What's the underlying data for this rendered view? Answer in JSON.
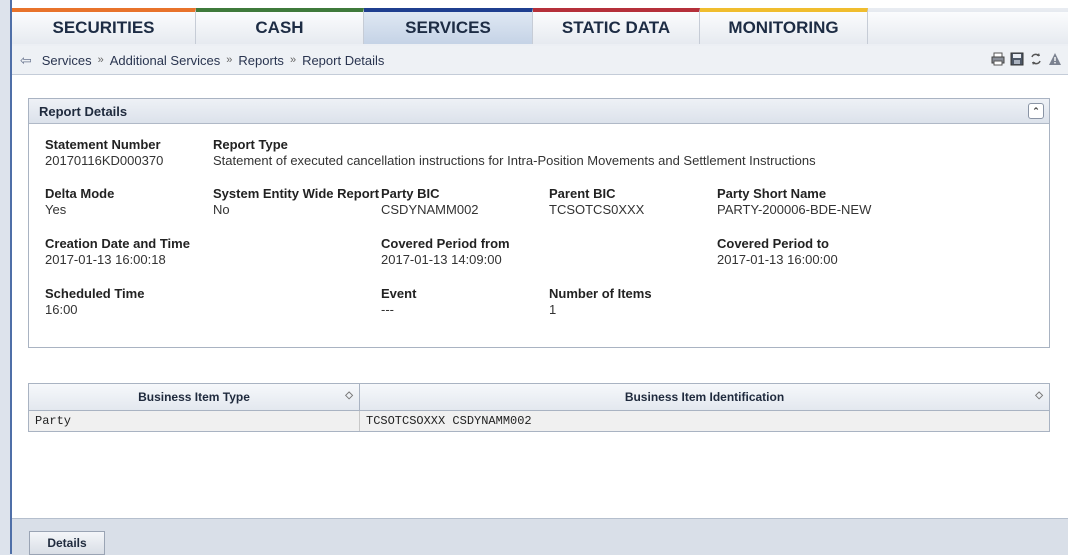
{
  "tabs": [
    {
      "label": "SECURITIES",
      "color": "#e8732b"
    },
    {
      "label": "CASH",
      "color": "#3f7a3b"
    },
    {
      "label": "SERVICES",
      "color": "#1f3f8f"
    },
    {
      "label": "STATIC DATA",
      "color": "#b5303a"
    },
    {
      "label": "MONITORING",
      "color": "#f0bd2e"
    }
  ],
  "breadcrumb": [
    "Services",
    "Additional Services",
    "Reports",
    "Report Details"
  ],
  "breadcrumb_separator": "»",
  "panel": {
    "title": "Report Details",
    "fields": {
      "statement_number": {
        "label": "Statement Number",
        "value": "20170116KD000370"
      },
      "report_type": {
        "label": "Report Type",
        "value": "Statement of executed cancellation instructions for Intra-Position Movements and Settlement Instructions"
      },
      "delta_mode": {
        "label": "Delta Mode",
        "value": "Yes"
      },
      "system_entity_wide_report": {
        "label": "System Entity Wide Report",
        "value": "No"
      },
      "party_bic": {
        "label": "Party BIC",
        "value": "CSDYNAMM002"
      },
      "parent_bic": {
        "label": "Parent BIC",
        "value": "TCSOTCS0XXX"
      },
      "party_short_name": {
        "label": "Party Short Name",
        "value": "PARTY-200006-BDE-NEW"
      },
      "creation_date_time": {
        "label": "Creation Date and Time",
        "value": "2017-01-13 16:00:18"
      },
      "covered_period_from": {
        "label": "Covered Period from",
        "value": "2017-01-13 14:09:00"
      },
      "covered_period_to": {
        "label": "Covered Period to",
        "value": "2017-01-13 16:00:00"
      },
      "scheduled_time": {
        "label": "Scheduled Time",
        "value": "16:00"
      },
      "event": {
        "label": "Event",
        "value": "---"
      },
      "number_of_items": {
        "label": "Number of Items",
        "value": "1"
      }
    }
  },
  "table": {
    "columns": [
      "Business Item Type",
      "Business Item Identification"
    ],
    "rows": [
      [
        "Party",
        "TCSOTCSOXXX CSDYNAMM002"
      ]
    ]
  },
  "buttons": {
    "details": "Details"
  }
}
